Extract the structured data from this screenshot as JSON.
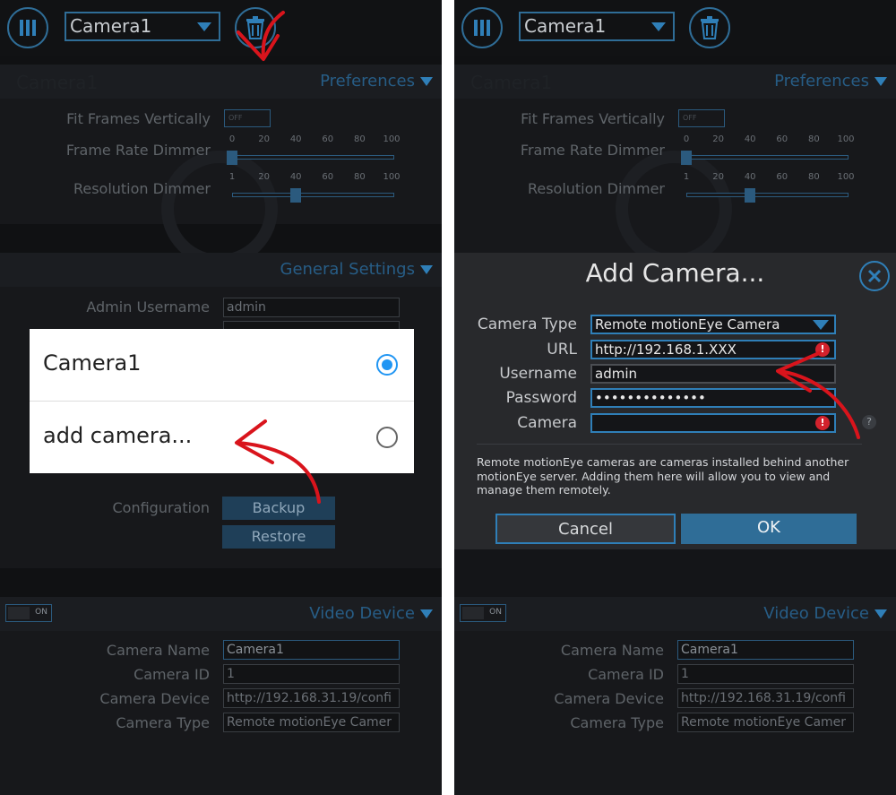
{
  "left": {
    "camera_select": "Camera1",
    "preferences": {
      "title": "Preferences",
      "ghost_title": "Camera1",
      "fit_frames_label": "Fit Frames Vertically",
      "fit_frames_state": "OFF",
      "frame_rate_label": "Frame Rate Dimmer",
      "frame_rate_ticks": [
        "0",
        "20",
        "40",
        "60",
        "80",
        "100"
      ],
      "frame_rate_value": 0,
      "resolution_label": "Resolution Dimmer",
      "resolution_ticks": [
        "1",
        "20",
        "40",
        "60",
        "80",
        "100"
      ],
      "resolution_value": 40
    },
    "general": {
      "title": "General Settings",
      "admin_username_label": "Admin Username",
      "admin_username_value": "admin",
      "configuration_label": "Configuration",
      "backup_label": "Backup",
      "restore_label": "Restore"
    },
    "video": {
      "title": "Video Device",
      "toggle_state": "ON",
      "camera_name_label": "Camera Name",
      "camera_name_value": "Camera1",
      "camera_id_label": "Camera ID",
      "camera_id_value": "1",
      "camera_device_label": "Camera Device",
      "camera_device_value": "http://192.168.31.19/confi",
      "camera_type_label": "Camera Type",
      "camera_type_value": "Remote motionEye Camer"
    },
    "popup": {
      "items": [
        {
          "label": "Camera1",
          "selected": true
        },
        {
          "label": "add camera...",
          "selected": false
        }
      ]
    }
  },
  "right": {
    "camera_select": "Camera1",
    "preferences_title": "Preferences",
    "ghost_title": "Camera1",
    "fit_frames_label": "Fit Frames Vertically",
    "fit_frames_state": "OFF",
    "frame_rate_label": "Frame Rate Dimmer",
    "frame_rate_ticks": [
      "0",
      "20",
      "40",
      "60",
      "80",
      "100"
    ],
    "resolution_label": "Resolution Dimmer",
    "resolution_ticks": [
      "1",
      "20",
      "40",
      "60",
      "80",
      "100"
    ],
    "video": {
      "title": "Video Device",
      "toggle_state": "ON",
      "camera_name_label": "Camera Name",
      "camera_name_value": "Camera1",
      "camera_id_label": "Camera ID",
      "camera_id_value": "1",
      "camera_device_label": "Camera Device",
      "camera_device_value": "http://192.168.31.19/confi",
      "camera_type_label": "Camera Type",
      "camera_type_value": "Remote motionEye Camer"
    },
    "dialog": {
      "title": "Add Camera...",
      "camera_type_label": "Camera Type",
      "camera_type_value": "Remote motionEye Camera",
      "url_label": "URL",
      "url_value": "http://192.168.1.XXX",
      "username_label": "Username",
      "username_value": "admin",
      "password_label": "Password",
      "password_value": "••••••••••••••",
      "camera_label": "Camera",
      "camera_value": "",
      "error_glyph": "!",
      "help_glyph": "?",
      "description": "Remote motionEye cameras are cameras installed behind another motionEye server. Adding them here will allow you to view and manage them remotely.",
      "cancel_label": "Cancel",
      "ok_label": "OK"
    }
  },
  "colors": {
    "accent": "#2f7fb8",
    "annotation_arrow": "#d9141c",
    "error": "#d2222d",
    "radio_selected": "#2196f3"
  },
  "icons": [
    "menu-icon",
    "trash-icon",
    "chevron-down-icon",
    "close-icon",
    "error-icon",
    "help-icon",
    "camera-off-watermark-icon"
  ]
}
